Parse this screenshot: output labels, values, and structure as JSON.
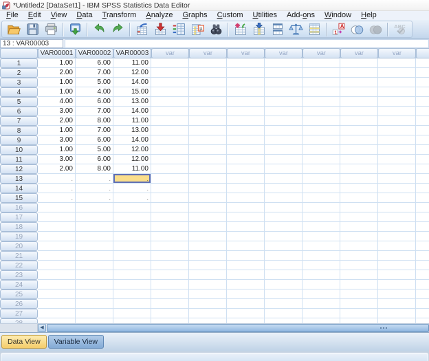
{
  "window": {
    "title": "*Untitled2 [DataSet1] - IBM SPSS Statistics Data Editor"
  },
  "menu_bar": {
    "items": [
      {
        "label": "File",
        "underline": 0
      },
      {
        "label": "Edit",
        "underline": 0
      },
      {
        "label": "View",
        "underline": 0
      },
      {
        "label": "Data",
        "underline": 0
      },
      {
        "label": "Transform",
        "underline": 0
      },
      {
        "label": "Analyze",
        "underline": 0
      },
      {
        "label": "Graphs",
        "underline": 0
      },
      {
        "label": "Custom",
        "underline": 0
      },
      {
        "label": "Utilities",
        "underline": 0
      },
      {
        "label": "Add-ons",
        "underline": 4
      },
      {
        "label": "Window",
        "underline": 0
      },
      {
        "label": "Help",
        "underline": 0
      }
    ]
  },
  "toolbar": {
    "items": [
      "open-file",
      "save",
      "print",
      "|",
      "recall-dialogs",
      "|",
      "undo",
      "redo",
      "|",
      "goto-case",
      "goto-variable",
      "variables",
      "variable-properties",
      "find",
      "|",
      "insert-case",
      "insert-variable",
      "split-file",
      "weight-cases",
      "select-cases",
      "|",
      "value-labels",
      "use-variable-sets",
      "show-all-variables",
      "|",
      "spell-check"
    ],
    "disabled": [
      "show-all-variables",
      "spell-check"
    ]
  },
  "cell_reference_bar": {
    "reference": "13 : VAR00003",
    "editor_value": ""
  },
  "data_grid": {
    "corner_label": "",
    "defined_columns": [
      "VAR00001",
      "VAR00002",
      "VAR00003"
    ],
    "placeholder_column_label": "var",
    "placeholder_column_count": 8,
    "visible_row_count": 28,
    "active_row_count": 15,
    "missing_value_symbol": ".",
    "rows": [
      {
        "n": 1,
        "values": [
          "1.00",
          "6.00",
          "11.00"
        ]
      },
      {
        "n": 2,
        "values": [
          "2.00",
          "7.00",
          "12.00"
        ]
      },
      {
        "n": 3,
        "values": [
          "1.00",
          "5.00",
          "14.00"
        ]
      },
      {
        "n": 4,
        "values": [
          "1.00",
          "4.00",
          "15.00"
        ]
      },
      {
        "n": 5,
        "values": [
          "4.00",
          "6.00",
          "13.00"
        ]
      },
      {
        "n": 6,
        "values": [
          "3.00",
          "7.00",
          "14.00"
        ]
      },
      {
        "n": 7,
        "values": [
          "2.00",
          "8.00",
          "11.00"
        ]
      },
      {
        "n": 8,
        "values": [
          "1.00",
          "7.00",
          "13.00"
        ]
      },
      {
        "n": 9,
        "values": [
          "3.00",
          "6.00",
          "14.00"
        ]
      },
      {
        "n": 10,
        "values": [
          "1.00",
          "5.00",
          "12.00"
        ]
      },
      {
        "n": 11,
        "values": [
          "3.00",
          "6.00",
          "12.00"
        ]
      },
      {
        "n": 12,
        "values": [
          "2.00",
          "8.00",
          "11.00"
        ]
      },
      {
        "n": 13,
        "values": [
          ".",
          ".",
          "."
        ]
      },
      {
        "n": 14,
        "values": [
          ".",
          ".",
          "."
        ]
      },
      {
        "n": 15,
        "values": [
          ".",
          ".",
          "."
        ]
      }
    ],
    "selected_cell": {
      "row": 13,
      "column": "VAR00003"
    }
  },
  "view_tabs": [
    {
      "label": "Data View",
      "active": true
    },
    {
      "label": "Variable View",
      "active": false
    }
  ],
  "status_bar": {
    "text": ""
  },
  "colors": {
    "selected_cell_fill": "#FBDE8B",
    "selected_cell_border": "#5F6FB5",
    "active_tab_fill": "#F5CC69",
    "inactive_tab_fill": "#83AAD5",
    "grid_line": "#CFE0F2",
    "header_fill": "#D4E2F3",
    "toolbar_fill": "#C2D6EC"
  }
}
